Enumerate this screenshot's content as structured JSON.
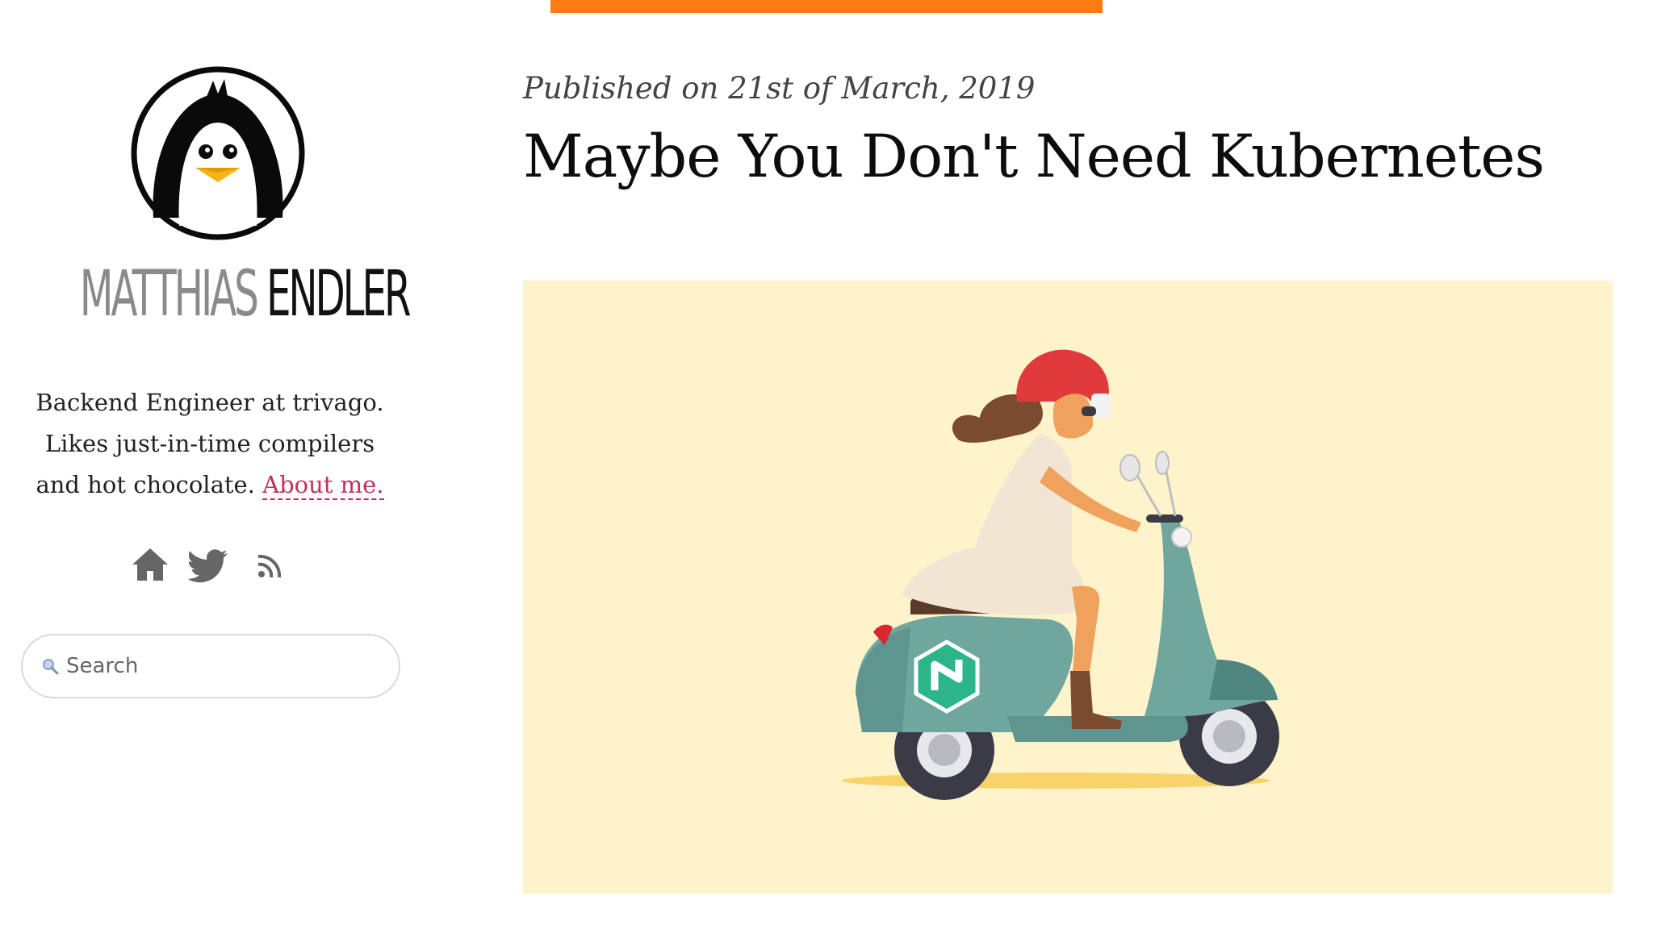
{
  "site": {
    "name_first": "MATTHIAS",
    "name_last": "ENDLER",
    "bio_text": "Backend Engineer at trivago. Likes just-in-time compilers and hot chocolate.",
    "about_link": "About me.",
    "avatar_icon": "penguin-icon"
  },
  "social": {
    "items": [
      {
        "icon": "home-icon"
      },
      {
        "icon": "twitter-icon"
      },
      {
        "icon": "rss-icon"
      }
    ]
  },
  "search": {
    "placeholder": "Search",
    "icon": "search-icon"
  },
  "post": {
    "date": "Published on 21st of March, 2019",
    "title": "Maybe You Don't Need Kubernetes",
    "hero_image": "woman-on-scooter-illustration"
  },
  "colors": {
    "accent_bar": "#ff7a12",
    "link": "#c1325c",
    "hero_bg": "#fff3cc",
    "scooter": "#6fa79f",
    "helmet": "#e03b3b",
    "logo_green": "#2db58a"
  }
}
